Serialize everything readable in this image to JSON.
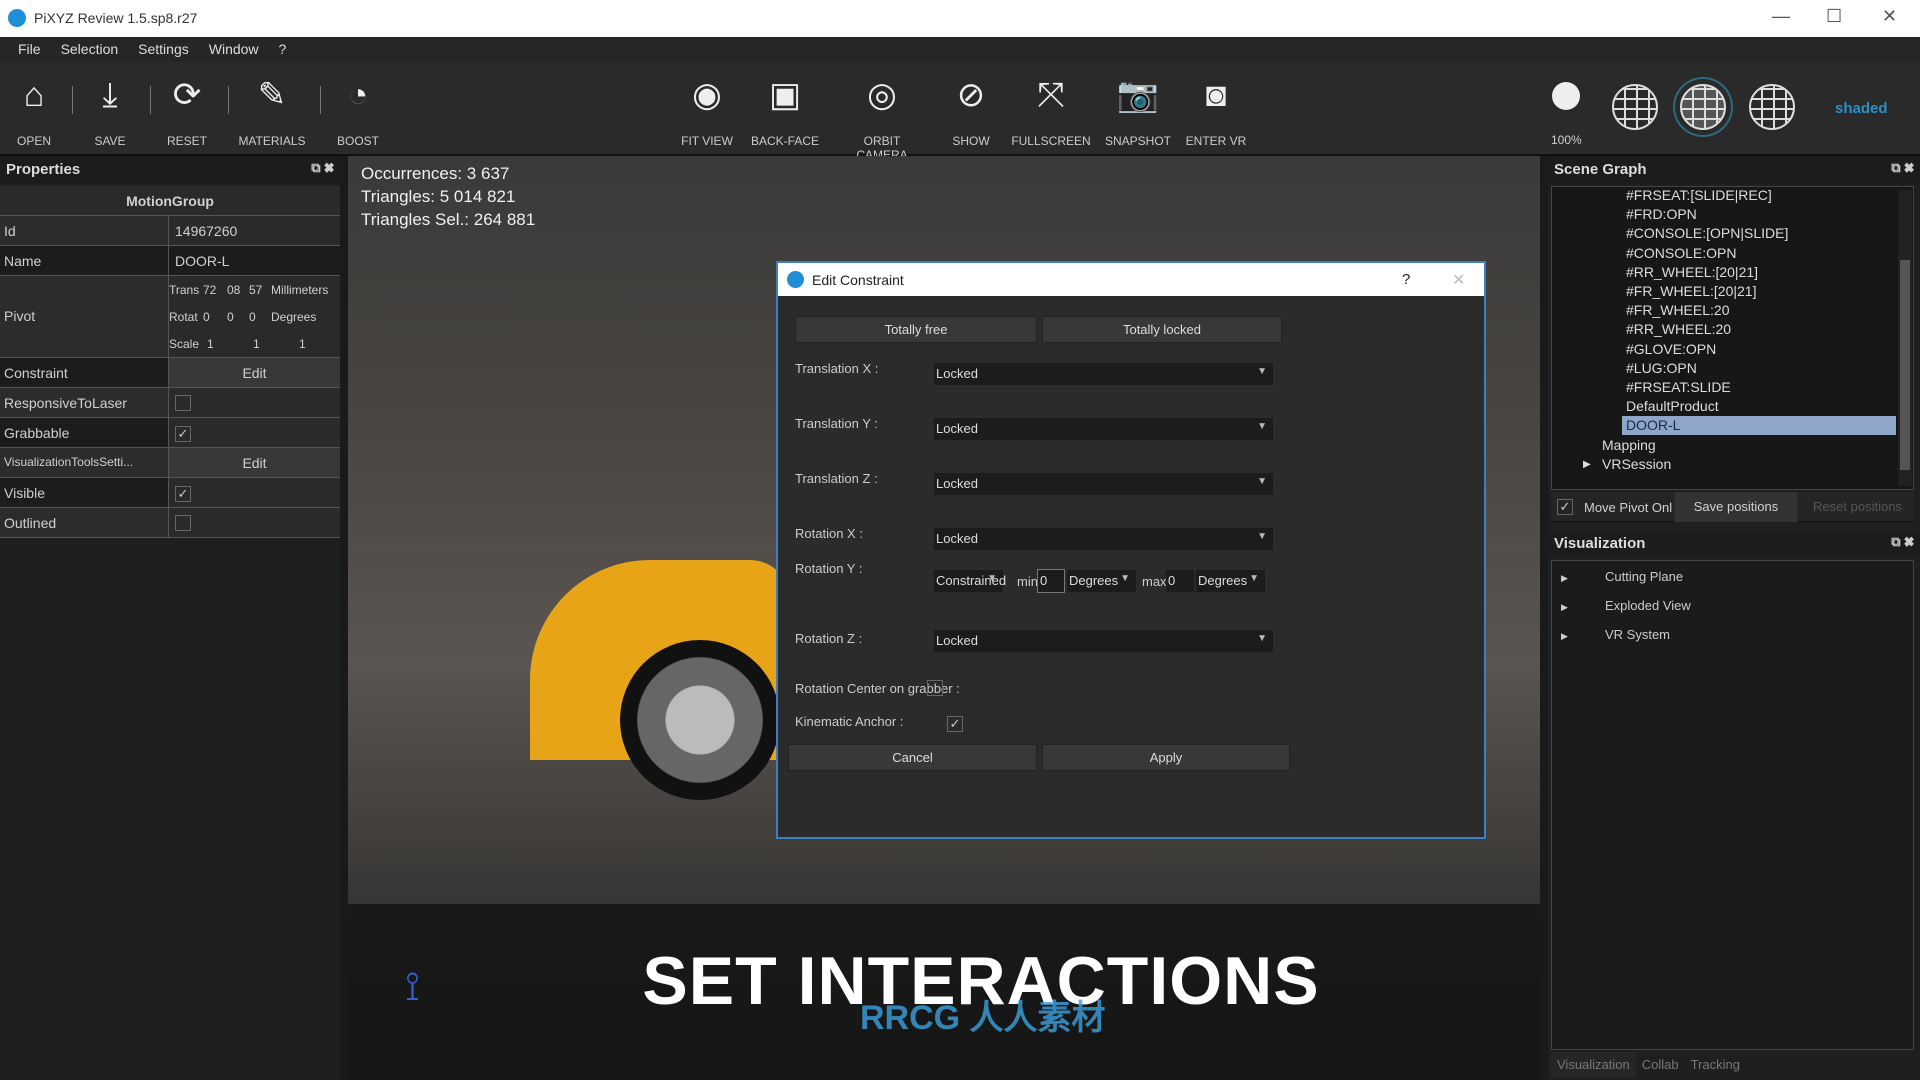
{
  "window": {
    "title": "PiXYZ Review 1.5.sp8.r27",
    "minimize": "—",
    "maximize": "☐",
    "close": "✕"
  },
  "menu": [
    "File",
    "Selection",
    "Settings",
    "Window",
    "?"
  ],
  "toolbar": {
    "left": [
      {
        "label": "OPEN",
        "icon": "open-icon",
        "glyph": "⌂"
      },
      {
        "label": "SAVE",
        "icon": "download-icon",
        "glyph": "⤓"
      },
      {
        "label": "RESET",
        "icon": "refresh-icon",
        "glyph": "⟳"
      },
      {
        "label": "MATERIALS",
        "icon": "edit-icon",
        "glyph": "✎"
      },
      {
        "label": "BOOST",
        "icon": "gauge-icon",
        "glyph": "◔"
      }
    ],
    "center": [
      {
        "label": "FIT VIEW",
        "icon": "eye-frame-icon",
        "glyph": "◉"
      },
      {
        "label": "BACK-FACE",
        "icon": "cube-icon",
        "glyph": "▣"
      },
      {
        "label": "ORBIT CAMERA",
        "icon": "orbit-icon",
        "glyph": "◎"
      },
      {
        "label": "SHOW",
        "icon": "eye-slash-icon",
        "glyph": "⊘"
      },
      {
        "label": "FULLSCREEN",
        "icon": "fullscreen-icon",
        "glyph": "⤧"
      },
      {
        "label": "SNAPSHOT",
        "icon": "camera-icon",
        "glyph": "📷"
      },
      {
        "label": "ENTER VR",
        "icon": "vr-headset-icon",
        "glyph": "◙"
      }
    ],
    "opacity": "100%",
    "render_mode": "shaded",
    "accent": "#2d8fc4"
  },
  "properties": {
    "title": "Properties",
    "group": "MotionGroup",
    "id_label": "Id",
    "id": "14967260",
    "name_label": "Name",
    "name": "DOOR-L",
    "pivot_label": "Pivot",
    "pivot": {
      "trans_label": "Trans",
      "trans": [
        "72",
        "08",
        "57"
      ],
      "trans_unit": "Millimeters",
      "rot_label": "Rotat",
      "rot": [
        "0",
        "0",
        "0"
      ],
      "rot_unit": "Degrees",
      "scale_label": "Scale",
      "scale": [
        "1",
        "1",
        "1"
      ]
    },
    "constraint_label": "Constraint",
    "edit": "Edit",
    "responsive_label": "ResponsiveToLaser",
    "responsive": false,
    "grabbable_label": "Grabbable",
    "grabbable": true,
    "vistools_label": "VisualizationToolsSetti...",
    "visible_label": "Visible",
    "visible": true,
    "outlined_label": "Outlined",
    "outlined": false
  },
  "viewport": {
    "stats": [
      "Occurrences: 3 637",
      "Triangles: 5 014 821",
      "Triangles Sel.: 264 881"
    ],
    "caption": "SET INTERACTIONS",
    "watermark": "RRCG 人人素材"
  },
  "dialog": {
    "title": "Edit Constraint",
    "help": "?",
    "close": "✕",
    "free": "Totally free",
    "locked": "Totally locked",
    "rows": [
      {
        "label": "Translation X :",
        "value": "Locked"
      },
      {
        "label": "Translation Y :",
        "value": "Locked"
      },
      {
        "label": "Translation Z :",
        "value": "Locked"
      },
      {
        "label": "Rotation X :",
        "value": "Locked"
      }
    ],
    "roty": {
      "label": "Rotation Y :",
      "mode": "Constrained",
      "min_label": "min",
      "min": "0",
      "min_unit": "Degrees",
      "max_label": "max",
      "max": "0",
      "max_unit": "Degrees"
    },
    "rotz": {
      "label": "Rotation Z :",
      "value": "Locked"
    },
    "rotcenter_label": "Rotation Center on grabber :",
    "rotcenter": false,
    "kinematic_label": "Kinematic Anchor :",
    "kinematic": true,
    "cancel": "Cancel",
    "apply": "Apply"
  },
  "scene_graph": {
    "title": "Scene Graph",
    "items": [
      "#FRSEAT:[SLIDE|REC]",
      "#FRD:OPN",
      "#CONSOLE:[OPN|SLIDE]",
      "#CONSOLE:OPN",
      "#RR_WHEEL:[20|21]",
      "#FR_WHEEL:[20|21]",
      "#FR_WHEEL:20",
      "#RR_WHEEL:20",
      "#GLOVE:OPN",
      "#LUG:OPN",
      "#FRSEAT:SLIDE",
      "DefaultProduct",
      "DOOR-L"
    ],
    "selected": "DOOR-L",
    "mapping": "Mapping",
    "vrsession": "VRSession",
    "move_pivot": "Move Pivot Onl",
    "move_pivot_checked": true,
    "save": "Save positions",
    "reset": "Reset positions",
    "selection_color": "#8fa6c8"
  },
  "visualization": {
    "title": "Visualization",
    "items": [
      "Cutting Plane",
      "Exploded View",
      "VR System"
    ],
    "tabs": [
      "Visualization",
      "Collab",
      "Tracking"
    ]
  }
}
